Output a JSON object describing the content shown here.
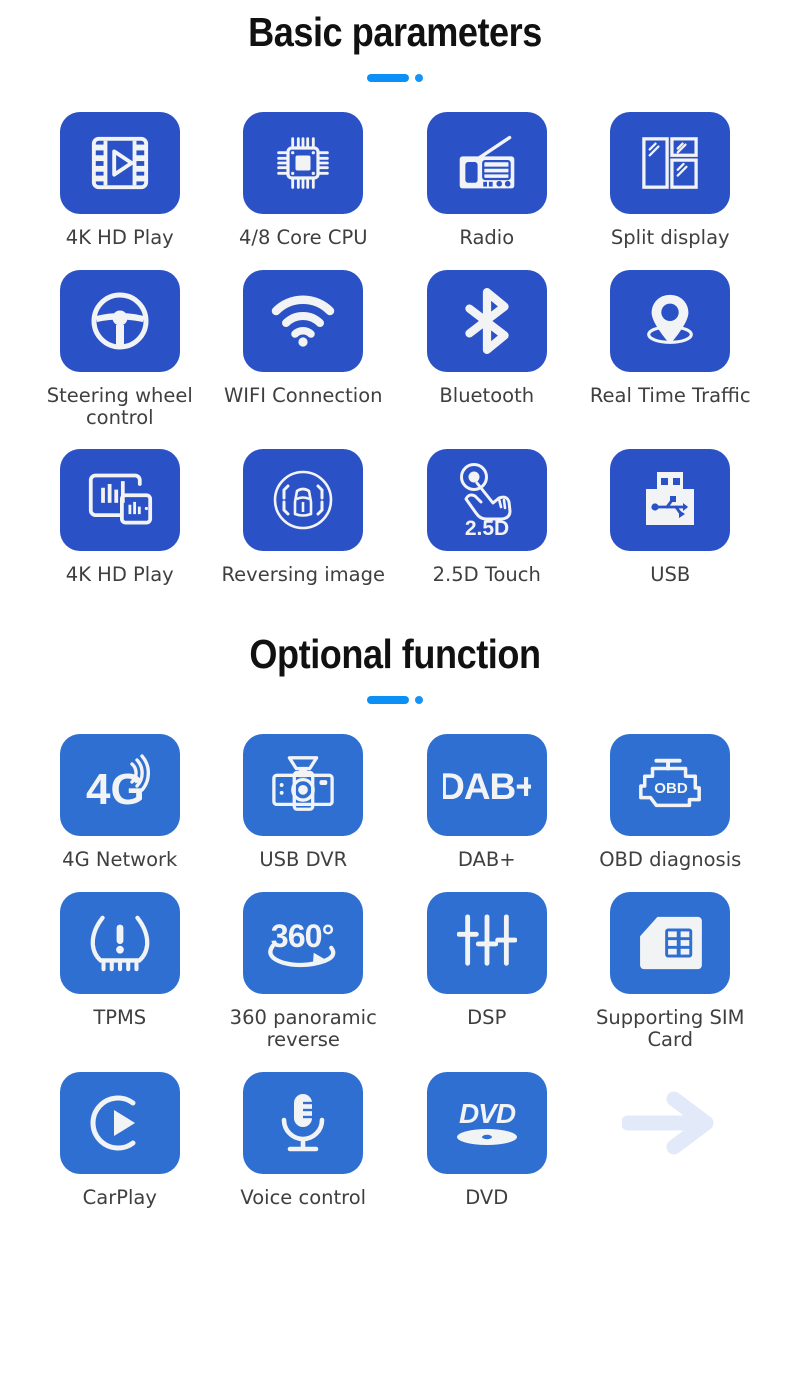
{
  "colors": {
    "tile_basic": "#2b51c6",
    "tile_optional": "#2f6fd2",
    "divider_bar": "#0d90f5",
    "divider_dot": "#1593f7",
    "caption_text": "#3f3f3f",
    "title_text": "#111111",
    "arrow": "#e2e9f8",
    "icon_glyph": "#f2f3f5"
  },
  "sections": [
    {
      "id": "basic-parameters",
      "title": "Basic parameters",
      "tile_style": "basic",
      "rows": [
        [
          {
            "label": "4K HD Play",
            "icon": "film-play-icon"
          },
          {
            "label": "4/8 Core CPU",
            "icon": "cpu-chip-icon"
          },
          {
            "label": "Radio",
            "icon": "radio-icon"
          },
          {
            "label": "Split display",
            "icon": "split-display-icon"
          }
        ],
        [
          {
            "label": "Steering wheel control",
            "icon": "steering-wheel-icon"
          },
          {
            "label": "WIFI Connection",
            "icon": "wifi-icon"
          },
          {
            "label": "Bluetooth",
            "icon": "bluetooth-icon"
          },
          {
            "label": "Real Time Traffic",
            "icon": "map-pin-icon"
          }
        ],
        [
          {
            "label": "4K HD Play",
            "icon": "screen-mirror-icon"
          },
          {
            "label": "Reversing image",
            "icon": "reversing-camera-icon"
          },
          {
            "label": "2.5D Touch",
            "icon": "touch-hand-icon",
            "badge": "2.5D"
          },
          {
            "label": "USB",
            "icon": "usb-drive-icon"
          }
        ]
      ]
    },
    {
      "id": "optional-function",
      "title": "Optional function",
      "tile_style": "opt",
      "rows": [
        [
          {
            "label": "4G Network",
            "icon": "4g-signal-icon",
            "badge": "4G"
          },
          {
            "label": "USB DVR",
            "icon": "dashcam-icon"
          },
          {
            "label": "DAB+",
            "icon": "dab-plus-icon",
            "badge": "DAB+"
          },
          {
            "label": "OBD diagnosis",
            "icon": "engine-obd-icon",
            "badge": "OBD"
          }
        ],
        [
          {
            "label": "TPMS",
            "icon": "tire-pressure-icon"
          },
          {
            "label": "360 panoramic reverse",
            "icon": "360-degree-icon",
            "badge": "360°"
          },
          {
            "label": "DSP",
            "icon": "equalizer-sliders-icon"
          },
          {
            "label": "Supporting SIM Card",
            "icon": "sim-card-icon"
          }
        ],
        [
          {
            "label": "CarPlay",
            "icon": "carplay-icon"
          },
          {
            "label": "Voice control",
            "icon": "microphone-icon"
          },
          {
            "label": "DVD",
            "icon": "dvd-disc-icon",
            "badge": "DVD"
          },
          {
            "label": "",
            "icon": "arrow-right-icon",
            "is_arrow": true
          }
        ]
      ]
    }
  ]
}
